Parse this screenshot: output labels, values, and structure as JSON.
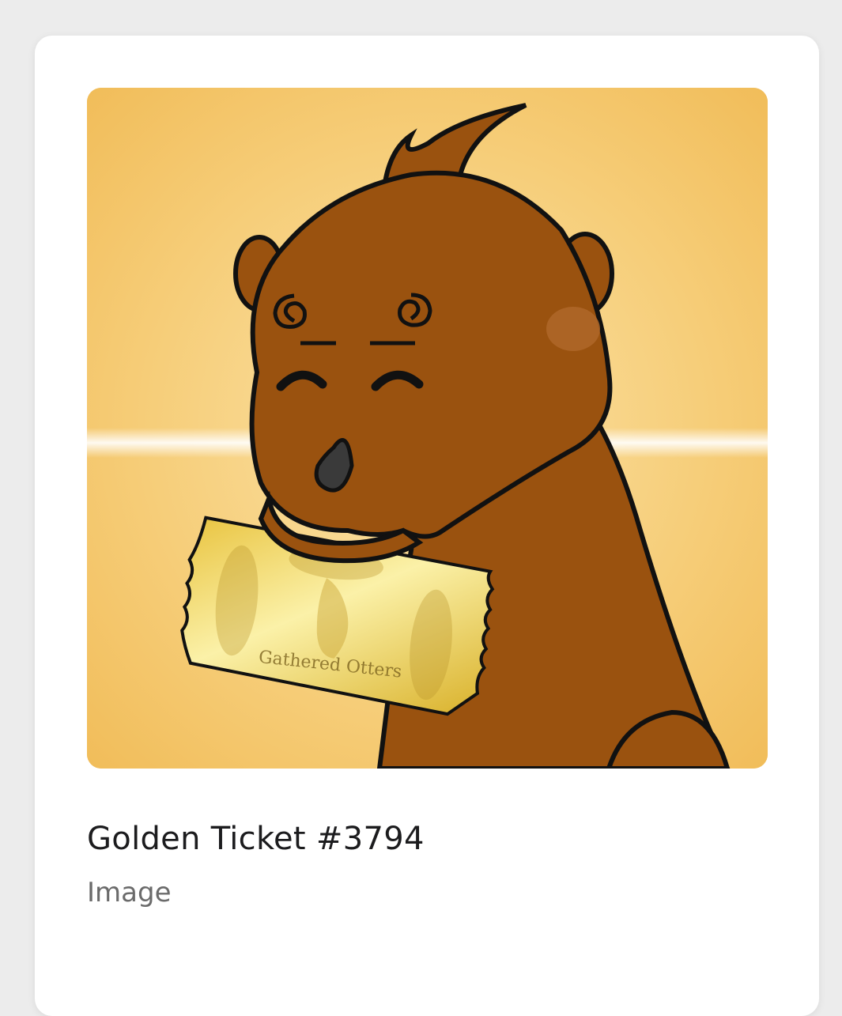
{
  "nft": {
    "title": "Golden Ticket #3794",
    "media_type": "Image",
    "artwork_icon": "otter-with-golden-ticket",
    "ticket_text": "Gathered Otters"
  },
  "colors": {
    "card_background": "#ffffff",
    "page_background": "#ececec",
    "art_background": "#f3c56a",
    "otter_fur": "#9a520f",
    "ticket_gold": "#e8c84a"
  }
}
